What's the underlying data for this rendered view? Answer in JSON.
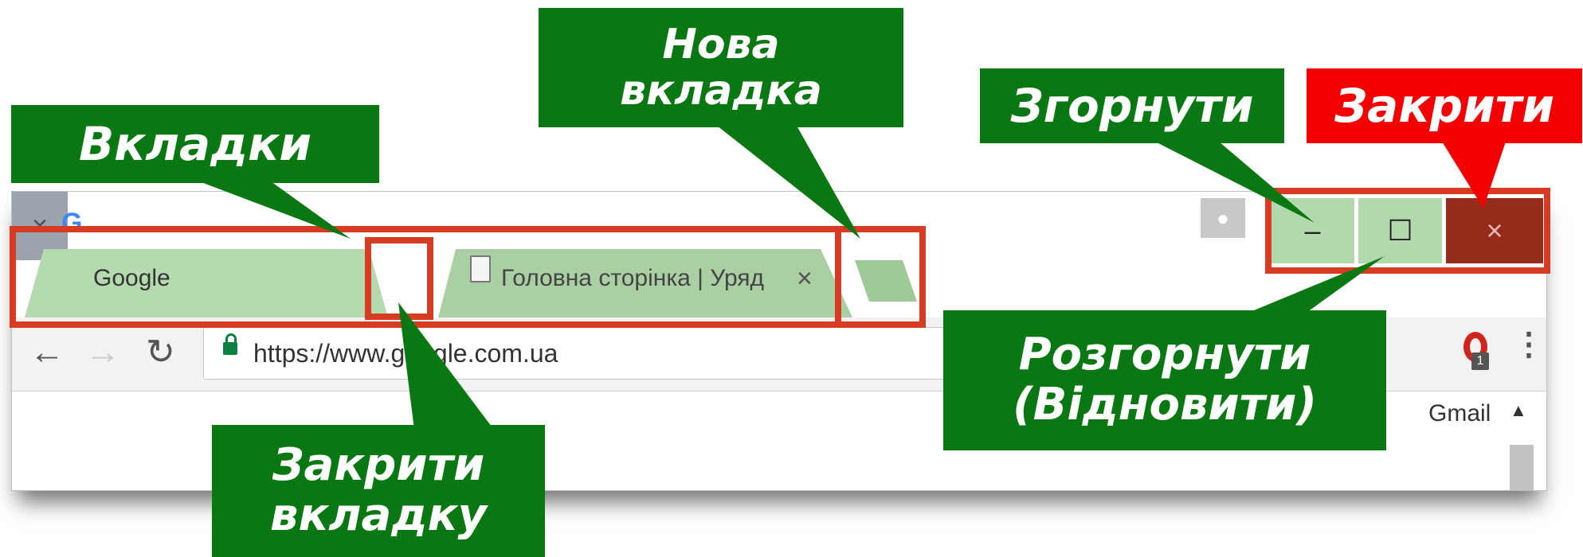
{
  "browser": {
    "tabs": [
      {
        "title": "Google",
        "favicon": "G"
      },
      {
        "title": "Головна сторінка | Уряд",
        "favicon": "page-icon"
      }
    ],
    "tab_close_glyph": "×",
    "window_controls": {
      "minimize": "–",
      "maximize": "☐",
      "close": "×"
    },
    "address_bar": {
      "url": "https://www.google.com.ua"
    },
    "extension_badge": "1",
    "page": {
      "gmail_link": "Gmail"
    }
  },
  "callouts": {
    "tabs": "Вкладки",
    "new_tab": "Нова вкладка",
    "minimize": "Згорнути",
    "close": "Закрити",
    "maximize": "Розгорнути (Відновити)",
    "close_tab": "Закрити вкладку"
  },
  "colors": {
    "callout_green": "#097812",
    "callout_red": "#f40000",
    "highlight_frame": "#d63c22",
    "highlight_fill": "#b4d8ad"
  }
}
